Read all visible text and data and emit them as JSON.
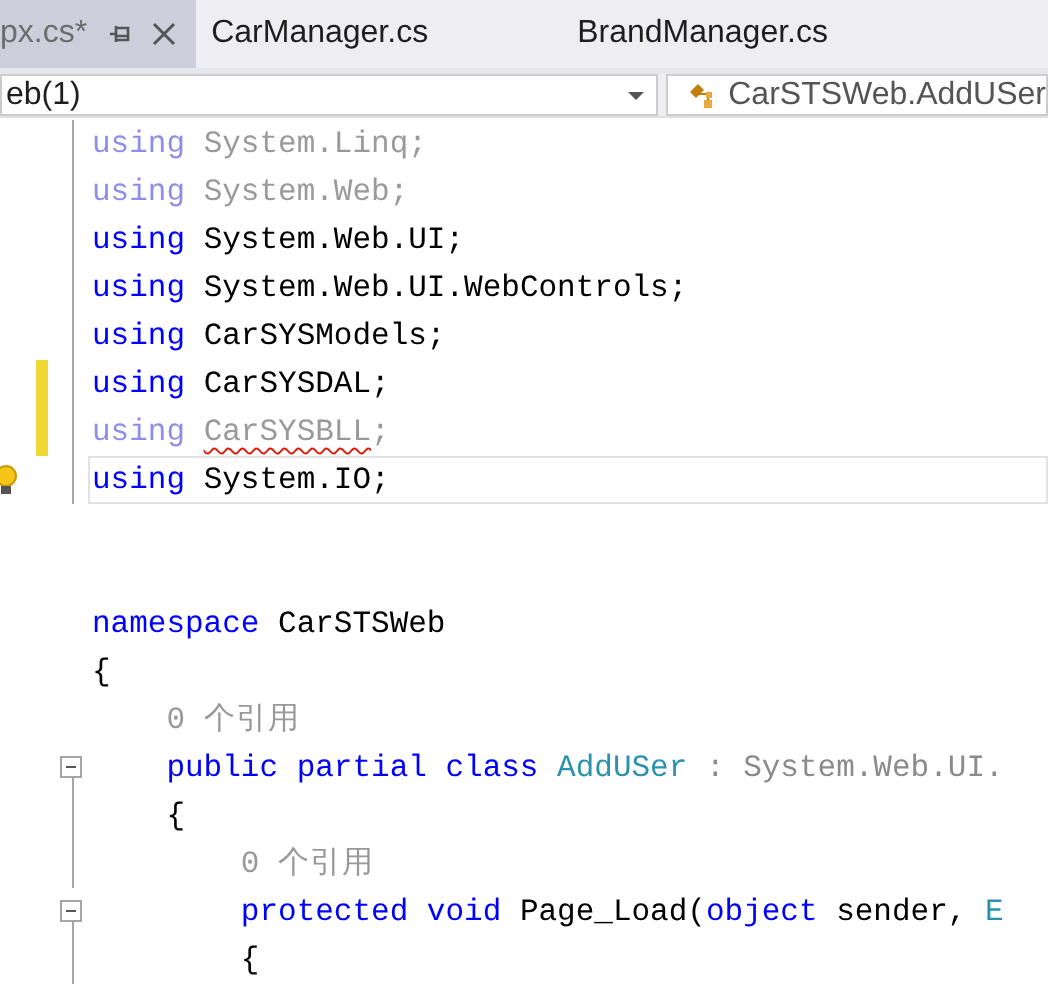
{
  "tabs": [
    {
      "label": "px.cs*",
      "selected": true,
      "pinnable": true,
      "closable": true
    },
    {
      "label": "CarManager.cs",
      "selected": false
    },
    {
      "label": "BrandManager.cs",
      "selected": false
    }
  ],
  "navigation_bar": {
    "project": "eb(1)",
    "member": "CarSTSWeb.AddUSer"
  },
  "lines": [
    {
      "kind": "code",
      "faded": true,
      "outlined": true,
      "tokens": [
        {
          "kind": "keyword",
          "text": "using"
        },
        {
          "kind": "plain",
          "text": " System.Linq;"
        }
      ]
    },
    {
      "kind": "code",
      "faded": true,
      "outlined": true,
      "tokens": [
        {
          "kind": "keyword",
          "text": "using"
        },
        {
          "kind": "plain",
          "text": " System.Web;"
        }
      ]
    },
    {
      "kind": "code",
      "outlined": true,
      "tokens": [
        {
          "kind": "keyword",
          "text": "using"
        },
        {
          "kind": "plain",
          "text": " System.Web.UI;"
        }
      ]
    },
    {
      "kind": "code",
      "outlined": true,
      "tokens": [
        {
          "kind": "keyword",
          "text": "using"
        },
        {
          "kind": "plain",
          "text": " System.Web.UI.WebControls;"
        }
      ]
    },
    {
      "kind": "code",
      "outlined": true,
      "tokens": [
        {
          "kind": "keyword",
          "text": "using"
        },
        {
          "kind": "plain",
          "text": " CarSYSModels;"
        }
      ]
    },
    {
      "kind": "code",
      "changed": true,
      "outlined": true,
      "tokens": [
        {
          "kind": "keyword",
          "text": "using"
        },
        {
          "kind": "plain",
          "text": " CarSYSDAL;"
        }
      ]
    },
    {
      "kind": "code",
      "faded": true,
      "changed": true,
      "outlined": true,
      "tokens": [
        {
          "kind": "keyword",
          "text": "using "
        },
        {
          "kind": "plain",
          "text": "CarSYSBLL",
          "error": true
        },
        {
          "kind": "plain",
          "text": ";"
        }
      ]
    },
    {
      "kind": "code",
      "current": true,
      "lightbulb": true,
      "outlined": true,
      "tokens": [
        {
          "kind": "keyword",
          "text": "using"
        },
        {
          "kind": "plain",
          "text": " System.IO;"
        }
      ]
    },
    {
      "kind": "blank"
    },
    {
      "kind": "blank"
    },
    {
      "kind": "code",
      "tokens": [
        {
          "kind": "keyword",
          "text": "namespace"
        },
        {
          "kind": "plain",
          "text": " CarSTSWeb"
        }
      ]
    },
    {
      "kind": "code",
      "tokens": [
        {
          "kind": "plain",
          "text": "{"
        }
      ]
    },
    {
      "kind": "code",
      "tokens": [
        {
          "kind": "hint",
          "text": "    0 个引用"
        }
      ]
    },
    {
      "kind": "code",
      "expanded": true,
      "tokens": [
        {
          "kind": "keyword",
          "text": "    public partial class "
        },
        {
          "kind": "type",
          "text": "AddUSer"
        },
        {
          "kind": "dim",
          "text": " : System.Web.UI."
        }
      ]
    },
    {
      "kind": "code",
      "outlined": true,
      "tokens": [
        {
          "kind": "plain",
          "text": "    {"
        }
      ]
    },
    {
      "kind": "code",
      "outlined": true,
      "tokens": [
        {
          "kind": "hint",
          "text": "        0 个引用"
        }
      ]
    },
    {
      "kind": "code",
      "expanded": true,
      "tokens": [
        {
          "kind": "keyword",
          "text": "        protected void"
        },
        {
          "kind": "plain",
          "text": " Page_Load("
        },
        {
          "kind": "keyword",
          "text": "object"
        },
        {
          "kind": "plain",
          "text": " sender, "
        },
        {
          "kind": "type",
          "text": "E"
        }
      ]
    },
    {
      "kind": "code",
      "outlined": true,
      "tokens": [
        {
          "kind": "plain",
          "text": "        {"
        }
      ]
    }
  ]
}
